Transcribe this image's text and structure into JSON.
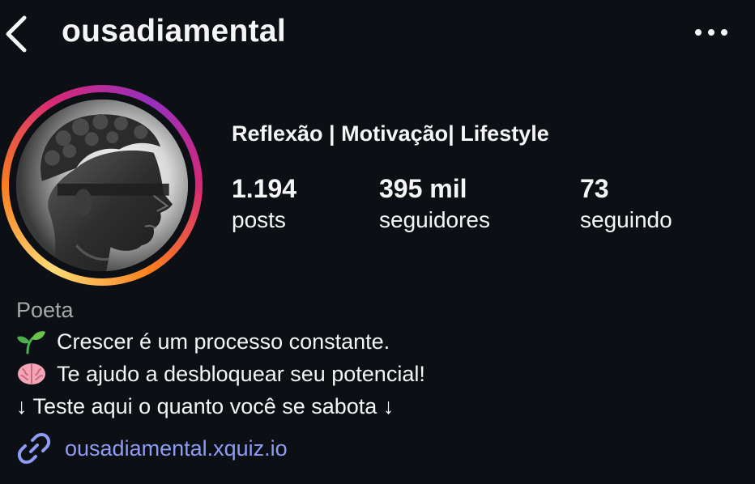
{
  "header": {
    "back_icon": "chevron-left-icon",
    "username": "ousadiamental",
    "more_icon": "more-horizontal-icon"
  },
  "profile": {
    "avatar_description": "profile-avatar",
    "story_ring_colors": [
      "#feda75",
      "#fa7e1e",
      "#d62976",
      "#962fbf"
    ],
    "category": "Reflexão | Motivação| Lifestyle",
    "stats": {
      "posts": {
        "value": "1.194",
        "label": "posts"
      },
      "followers": {
        "value": "395 mil",
        "label": "seguidores"
      },
      "following": {
        "value": "73",
        "label": "seguindo"
      }
    }
  },
  "bio": {
    "role": "Poeta",
    "lines": [
      {
        "icon": "seedling-icon",
        "text": "Crescer é um processo constante."
      },
      {
        "icon": "brain-icon",
        "text": "Te ajudo a desbloquear seu potencial!"
      },
      {
        "icon": "",
        "text": "↓ Teste aqui o quanto você se sabota ↓"
      }
    ],
    "link": {
      "icon": "link-icon",
      "text": "ousadiamental.xquiz.io"
    }
  },
  "colors": {
    "background": "#0c1014",
    "text_primary": "#f5f5f5",
    "text_secondary": "#a8a8a8",
    "link": "#8e9cf5"
  }
}
